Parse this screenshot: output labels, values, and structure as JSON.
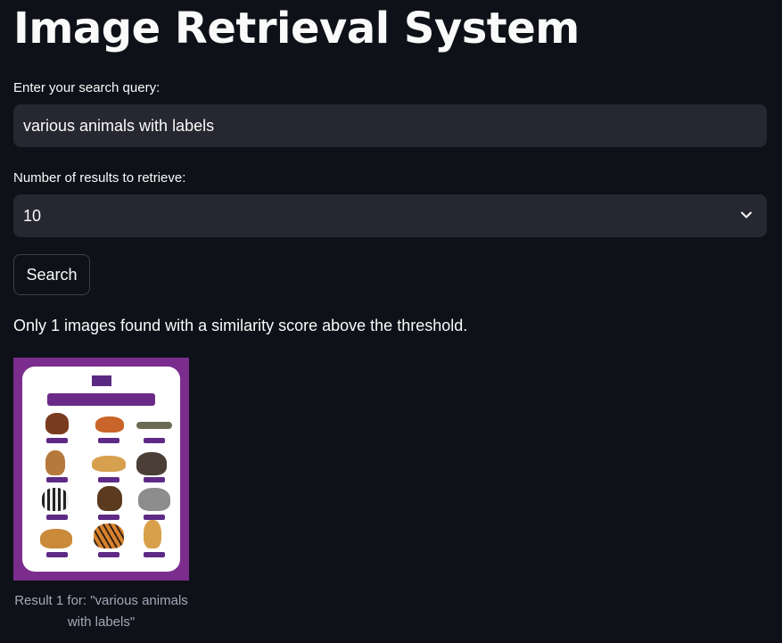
{
  "page_title": "Image Retrieval System",
  "query": {
    "label": "Enter your search query:",
    "value": "various animals with labels"
  },
  "num_results": {
    "label": "Number of results to retrieve:",
    "selected": "10"
  },
  "search_button": "Search",
  "info_message": "Only 1 images found with a similarity score above the threshold.",
  "results": [
    {
      "caption": "Result 1 for: \"various animals with labels\"",
      "image_icon": "wild-animals-poster-image"
    }
  ],
  "colors": {
    "background": "#0e1117",
    "input_bg": "#262730",
    "poster_frame": "#7b2d8e"
  }
}
